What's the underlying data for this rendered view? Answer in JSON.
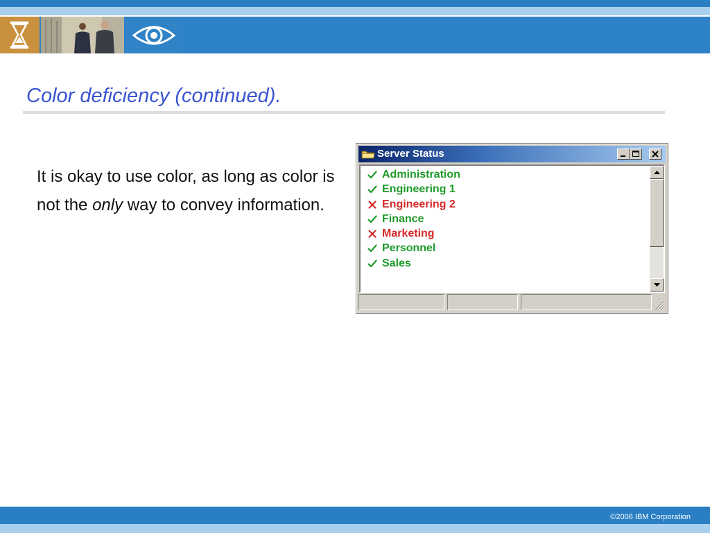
{
  "slide": {
    "title": "Color deficiency (continued).",
    "body_before": "It is okay to use color, as long as color is not the",
    "body_emphasis": "only",
    "body_after": "way to convey information."
  },
  "header": {
    "tiles": [
      "hourglass-icon",
      "business-people-photo",
      "eye-icon"
    ],
    "colors": {
      "stripe": "#2a7fc4",
      "band": "#2d82c7",
      "light": "#a8d0ee"
    }
  },
  "window": {
    "title": "Server Status",
    "icon": "folder-icon",
    "controls": [
      "minimize-icon",
      "maximize-icon",
      "close-icon"
    ],
    "items": [
      {
        "label": "Administration",
        "status": "ok",
        "color": "#1e9a28"
      },
      {
        "label": "Engineering 1",
        "status": "ok",
        "color": "#1e9a28"
      },
      {
        "label": "Engineering 2",
        "status": "error",
        "color": "#d42a2a"
      },
      {
        "label": "Finance",
        "status": "ok",
        "color": "#1e9a28"
      },
      {
        "label": "Marketing",
        "status": "error",
        "color": "#d42a2a"
      },
      {
        "label": "Personnel",
        "status": "ok",
        "color": "#1e9a28"
      },
      {
        "label": "Sales",
        "status": "ok",
        "color": "#1e9a28"
      }
    ]
  },
  "footer": {
    "copyright": "©2006 IBM Corporation"
  }
}
